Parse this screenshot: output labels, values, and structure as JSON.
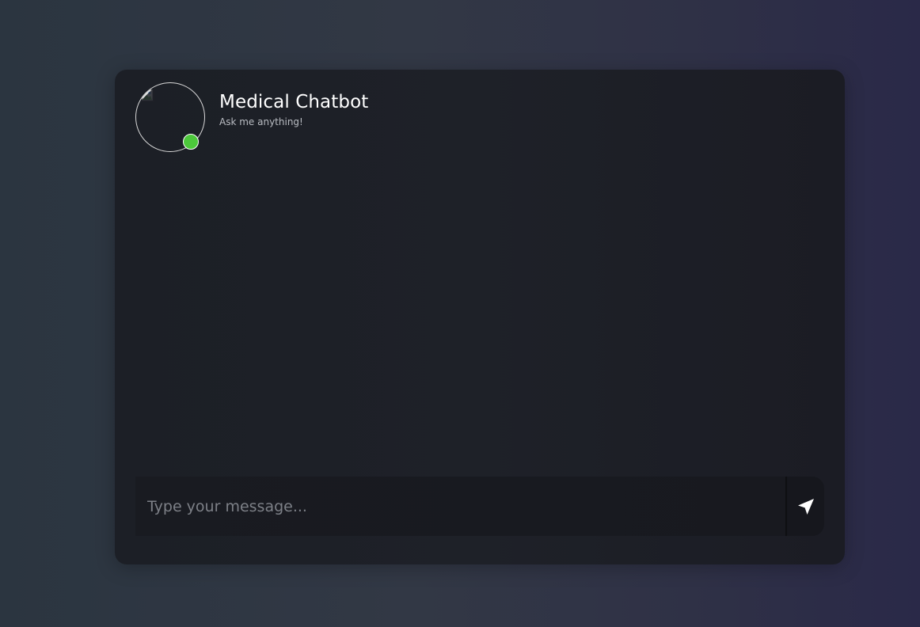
{
  "header": {
    "title": "Medical Chatbot",
    "subtitle": "Ask me anything!",
    "status": "online",
    "avatar_icon": "broken-image-icon"
  },
  "composer": {
    "placeholder": "Type your message...",
    "value": "",
    "send_icon": "send-arrow-icon"
  },
  "messages": [],
  "colors": {
    "online_indicator": "#4cc83b",
    "title_text": "#ffffff",
    "subtitle_text": "#b9bcc2",
    "card_background": "#1e2128"
  }
}
